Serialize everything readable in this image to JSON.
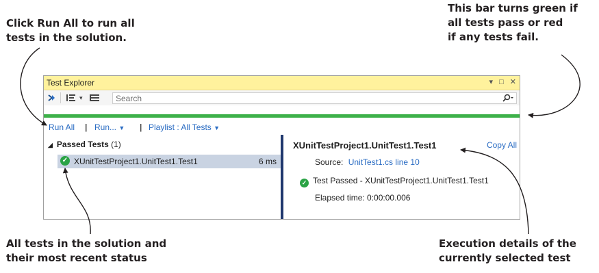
{
  "callouts": {
    "top_left_line1": "Click Run All to run all",
    "top_left_line2": "tests in the solution.",
    "top_right_line1": "This bar turns green if",
    "top_right_line2": "all tests pass or red",
    "top_right_line3": "if any tests fail.",
    "bottom_left_line1": "All tests in the solution and",
    "bottom_left_line2": "their most recent status",
    "bottom_right_line1": "Execution details of the",
    "bottom_right_line2": "currently selected test"
  },
  "window": {
    "title": "Test Explorer",
    "controls": {
      "dropdown": "▾",
      "maximize": "□",
      "close": "✕"
    }
  },
  "toolbar": {
    "search_placeholder": "Search",
    "icons": [
      "run-tests-icon",
      "group-by-icon",
      "playlist-icon",
      "search-icon"
    ]
  },
  "status_bar": {
    "color": "#3db149",
    "state": "passed"
  },
  "commands": {
    "run_all": "Run All",
    "run": "Run...",
    "playlist": "Playlist : All Tests"
  },
  "tests": {
    "group_label": "Passed Tests",
    "group_count": "(1)",
    "items": [
      {
        "name": "XUnitTestProject1.UnitTest1.Test1",
        "duration": "6 ms",
        "status": "passed"
      }
    ]
  },
  "details": {
    "title": "XUnitTestProject1.UnitTest1.Test1",
    "copy_all": "Copy All",
    "source_label": "Source:",
    "source_link": "UnitTest1.cs line 10",
    "result_text": "Test Passed - XUnitTestProject1.UnitTest1.Test1",
    "elapsed": "Elapsed time: 0:00:00.006"
  },
  "colors": {
    "accent_link": "#2a6cc3",
    "titlebar": "#fff29d",
    "selection": "#c9d3e2",
    "pass_green": "#2aa345",
    "splitter": "#20386e"
  }
}
